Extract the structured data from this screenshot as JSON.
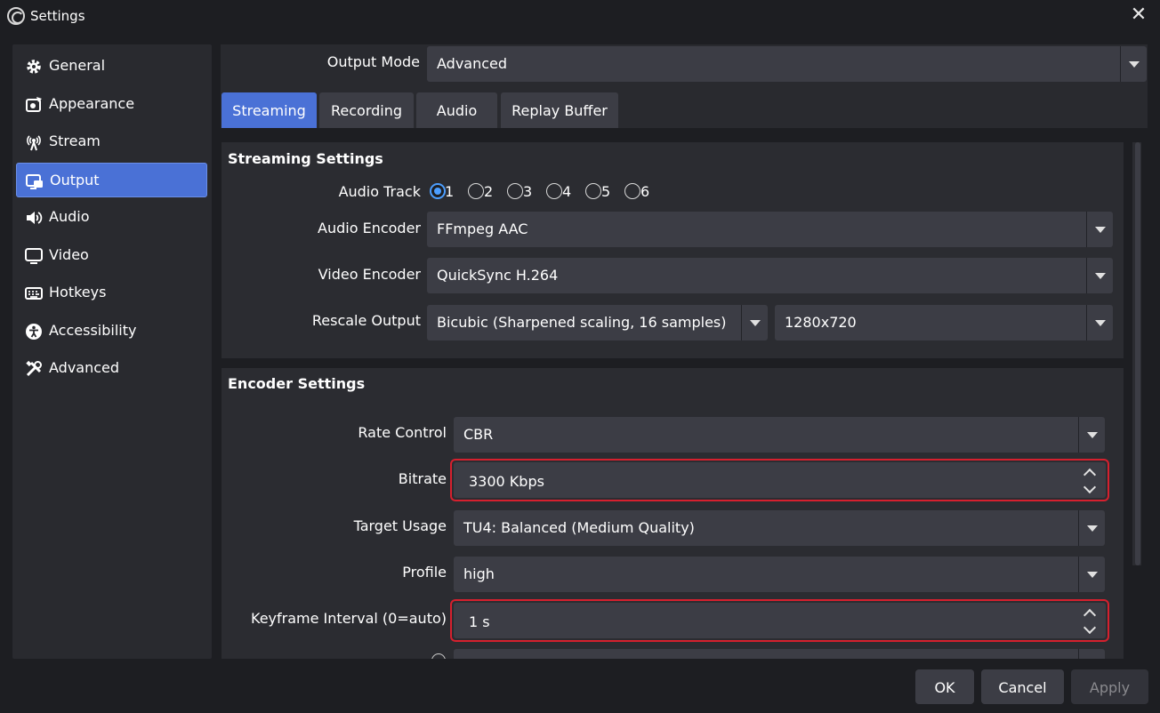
{
  "window": {
    "title": "Settings"
  },
  "sidebar": {
    "items": [
      {
        "label": "General",
        "icon": "gear-icon"
      },
      {
        "label": "Appearance",
        "icon": "appearance-icon"
      },
      {
        "label": "Stream",
        "icon": "antenna-icon"
      },
      {
        "label": "Output",
        "icon": "output-icon",
        "active": true
      },
      {
        "label": "Audio",
        "icon": "speaker-icon"
      },
      {
        "label": "Video",
        "icon": "monitor-icon"
      },
      {
        "label": "Hotkeys",
        "icon": "keyboard-icon"
      },
      {
        "label": "Accessibility",
        "icon": "accessibility-icon"
      },
      {
        "label": "Advanced",
        "icon": "tools-icon"
      }
    ]
  },
  "output_mode": {
    "label": "Output Mode",
    "value": "Advanced"
  },
  "tabs": [
    {
      "label": "Streaming",
      "active": true
    },
    {
      "label": "Recording"
    },
    {
      "label": "Audio"
    },
    {
      "label": "Replay Buffer"
    }
  ],
  "streaming_settings": {
    "title": "Streaming Settings",
    "audio_track": {
      "label": "Audio Track",
      "options": [
        "1",
        "2",
        "3",
        "4",
        "5",
        "6"
      ],
      "selected": "1"
    },
    "audio_encoder": {
      "label": "Audio Encoder",
      "value": "FFmpeg AAC"
    },
    "video_encoder": {
      "label": "Video Encoder",
      "value": "QuickSync H.264"
    },
    "rescale_output": {
      "label": "Rescale Output",
      "filter": "Bicubic (Sharpened scaling, 16 samples)",
      "resolution": "1280x720"
    }
  },
  "encoder_settings": {
    "title": "Encoder Settings",
    "rate_control": {
      "label": "Rate Control",
      "value": "CBR"
    },
    "bitrate": {
      "label": "Bitrate",
      "value": "3300 Kbps"
    },
    "target_usage": {
      "label": "Target Usage",
      "value": "TU4: Balanced (Medium Quality)"
    },
    "profile": {
      "label": "Profile",
      "value": "high"
    },
    "keyframe_interval": {
      "label": "Keyframe Interval (0=auto)",
      "value": "1 s"
    }
  },
  "buttons": {
    "ok": "OK",
    "cancel": "Cancel",
    "apply": "Apply"
  },
  "colors": {
    "accent": "#4a71d6",
    "highlight": "#d6202e",
    "background": "#1d1e22",
    "panel": "#292a2f",
    "field": "#3c3d45"
  }
}
